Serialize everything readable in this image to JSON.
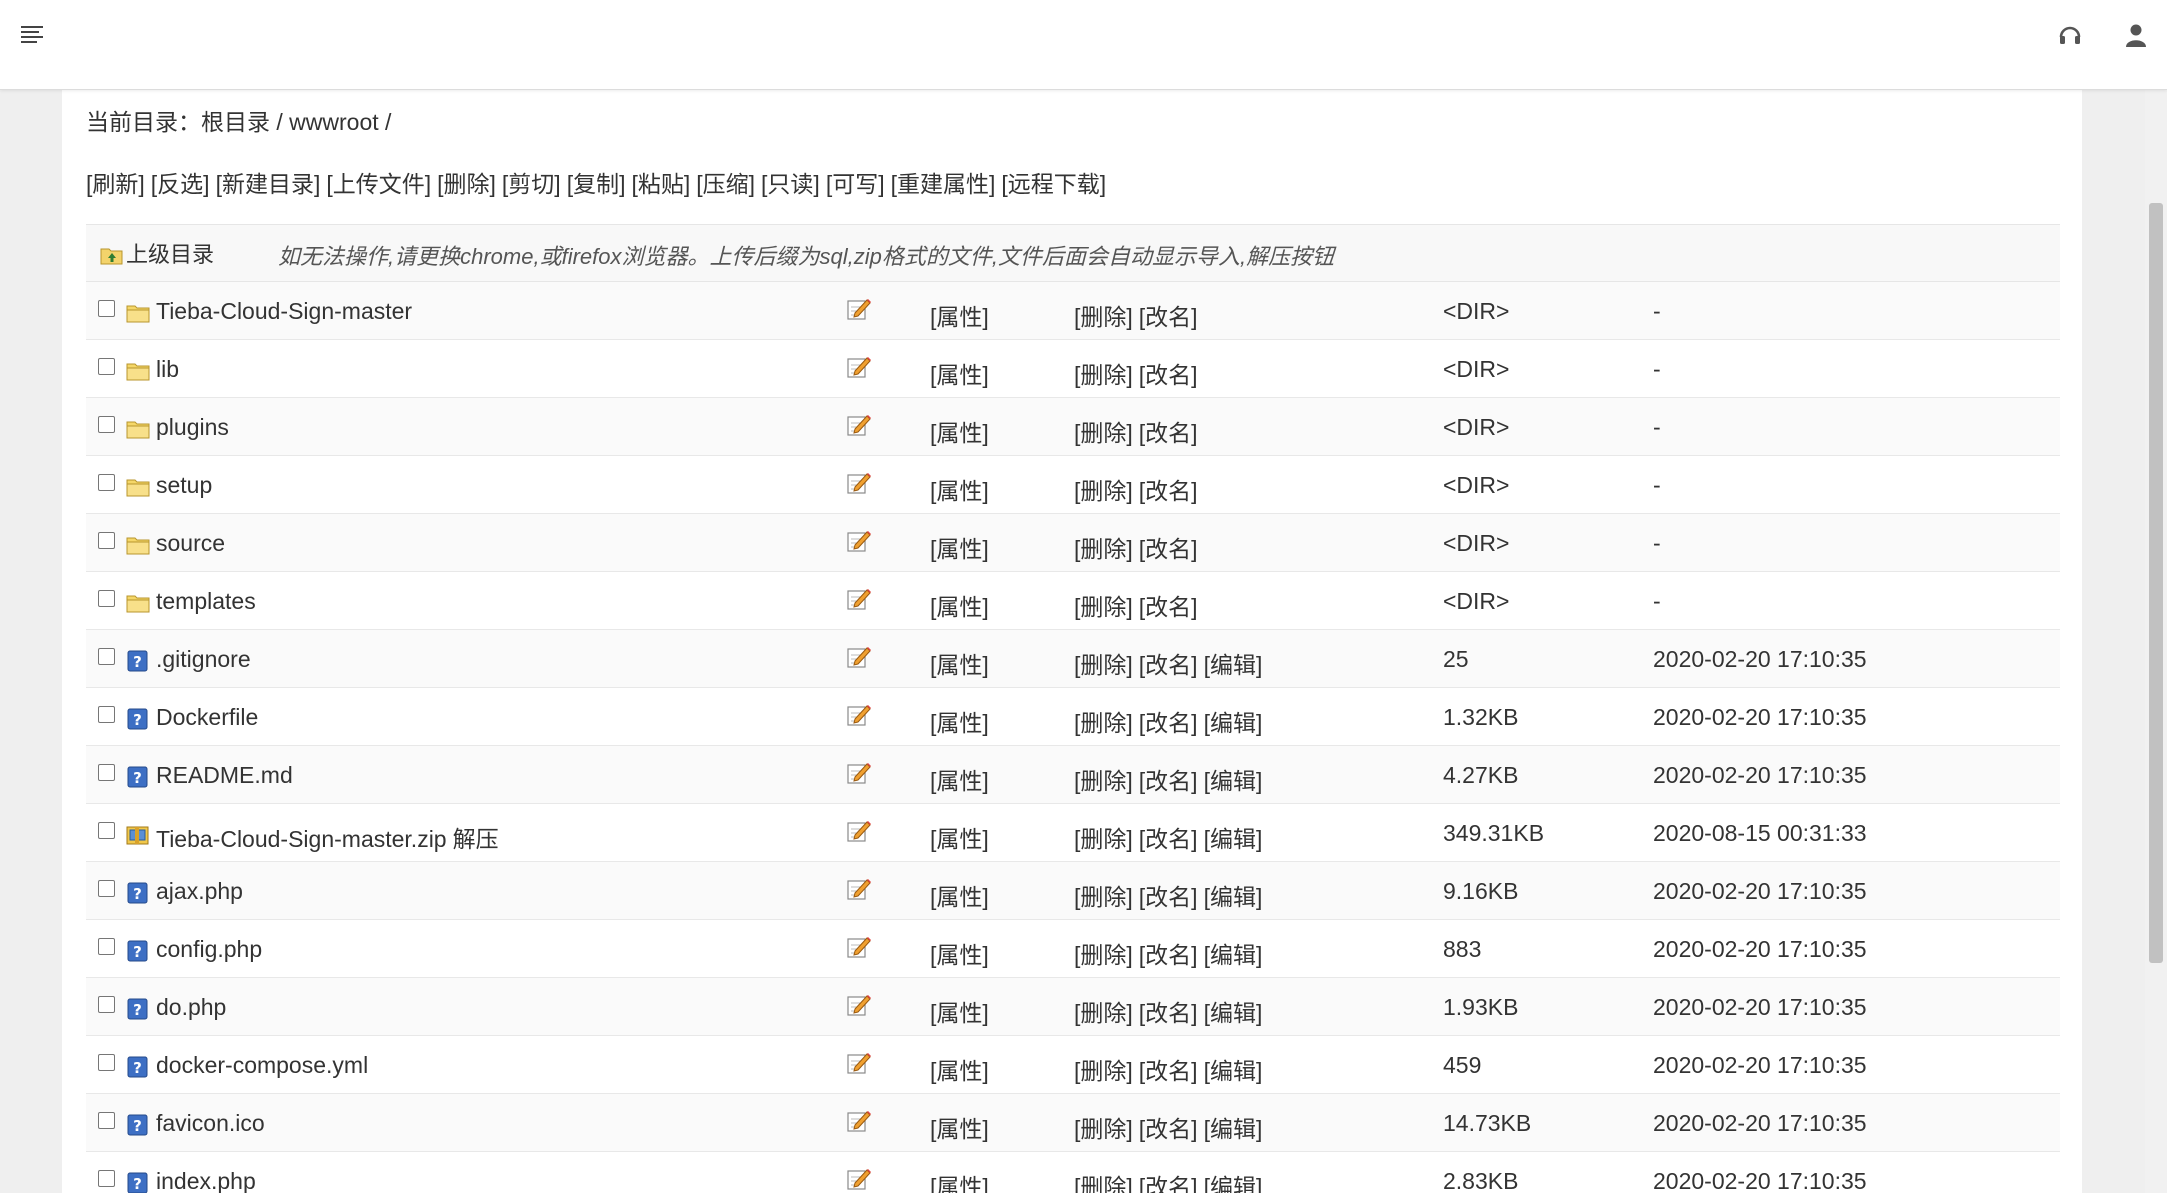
{
  "current_dir": {
    "label": "当前目录：",
    "root": "根目录",
    "sep1": " / ",
    "folder": "wwwroot",
    "sep2": " /"
  },
  "toolbar": [
    "[刷新]",
    "[反选]",
    "[新建目录]",
    "[上传文件]",
    "[删除]",
    "[剪切]",
    "[复制]",
    "[粘贴]",
    "[压缩]",
    "[只读]",
    "[可写]",
    "[重建属性]",
    "[远程下载]"
  ],
  "parent_dir": {
    "label": "上级目录",
    "notice": "如无法操作,请更换chrome,或firefox浏览器。上传后缀为sql,zip格式的文件,文件后面会自动显示导入,解压按钮"
  },
  "labels": {
    "properties": "[属性]",
    "delete": "[删除]",
    "rename": "[改名]",
    "edit": "[编辑]"
  },
  "files": [
    {
      "name": "Tieba-Cloud-Sign-master",
      "type": "folder",
      "size": "<DIR>",
      "time": "-",
      "editable": false
    },
    {
      "name": "lib",
      "type": "folder",
      "size": "<DIR>",
      "time": "-",
      "editable": false
    },
    {
      "name": "plugins",
      "type": "folder",
      "size": "<DIR>",
      "time": "-",
      "editable": false
    },
    {
      "name": "setup",
      "type": "folder",
      "size": "<DIR>",
      "time": "-",
      "editable": false
    },
    {
      "name": "source",
      "type": "folder",
      "size": "<DIR>",
      "time": "-",
      "editable": false
    },
    {
      "name": "templates",
      "type": "folder",
      "size": "<DIR>",
      "time": "-",
      "editable": false
    },
    {
      "name": ".gitignore",
      "type": "file",
      "size": "25",
      "time": "2020-02-20 17:10:35",
      "editable": true
    },
    {
      "name": "Dockerfile",
      "type": "file",
      "size": "1.32KB",
      "time": "2020-02-20 17:10:35",
      "editable": true
    },
    {
      "name": "README.md",
      "type": "file",
      "size": "4.27KB",
      "time": "2020-02-20 17:10:35",
      "editable": true
    },
    {
      "name": "Tieba-Cloud-Sign-master.zip",
      "type": "zip",
      "extra": "解压",
      "size": "349.31KB",
      "time": "2020-08-15 00:31:33",
      "editable": true
    },
    {
      "name": "ajax.php",
      "type": "file",
      "size": "9.16KB",
      "time": "2020-02-20 17:10:35",
      "editable": true
    },
    {
      "name": "config.php",
      "type": "file",
      "size": "883",
      "time": "2020-02-20 17:10:35",
      "editable": true
    },
    {
      "name": "do.php",
      "type": "file",
      "size": "1.93KB",
      "time": "2020-02-20 17:10:35",
      "editable": true
    },
    {
      "name": "docker-compose.yml",
      "type": "file",
      "size": "459",
      "time": "2020-02-20 17:10:35",
      "editable": true
    },
    {
      "name": "favicon.ico",
      "type": "file",
      "size": "14.73KB",
      "time": "2020-02-20 17:10:35",
      "editable": true
    },
    {
      "name": "index.php",
      "type": "file",
      "size": "2.83KB",
      "time": "2020-02-20 17:10:35",
      "editable": true
    }
  ]
}
